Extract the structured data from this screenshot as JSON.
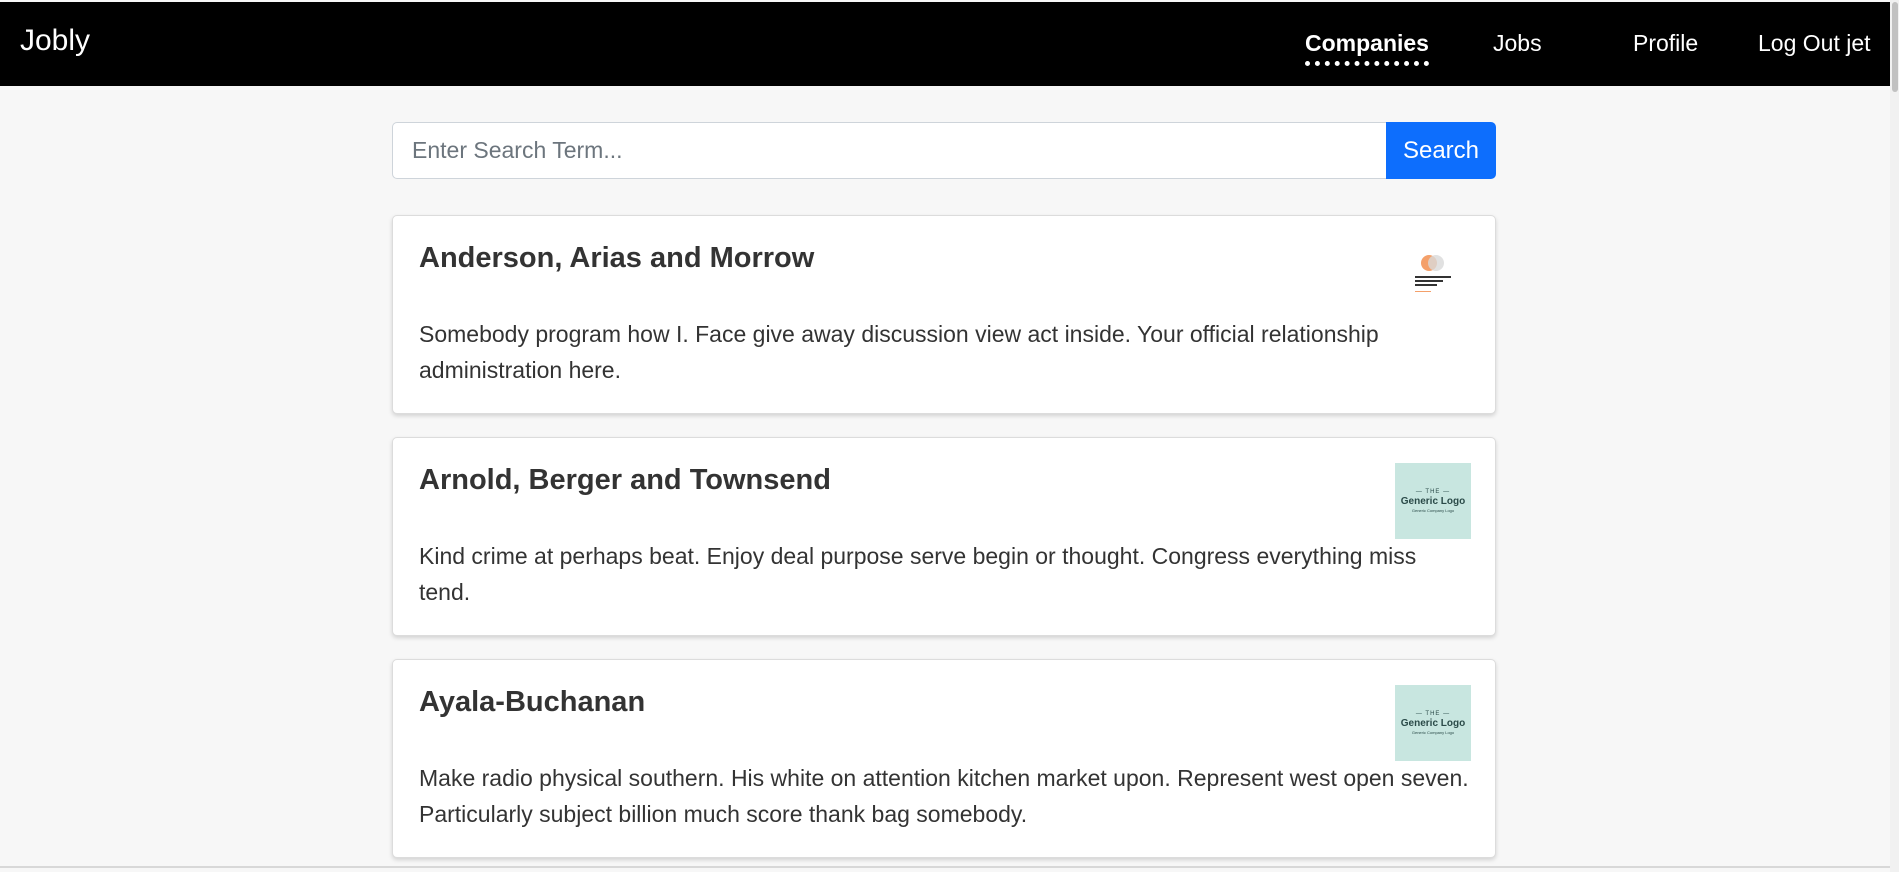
{
  "nav": {
    "brand": "Jobly",
    "links": [
      {
        "label": "Companies",
        "active": true
      },
      {
        "label": "Jobs",
        "active": false
      },
      {
        "label": "Profile",
        "active": false
      },
      {
        "label": "Log Out jet",
        "active": false
      }
    ]
  },
  "search": {
    "placeholder": "Enter Search Term...",
    "value": "",
    "button_label": "Search"
  },
  "companies": [
    {
      "name": "Anderson, Arias and Morrow",
      "description": "Somebody program how I. Face give away discussion view act inside. Your official relationship administration here.",
      "logo_text": "Anderson, Arias and Morrow",
      "logo_icon": "orange-circles-logo"
    },
    {
      "name": "Arnold, Berger and Townsend",
      "description": "Kind crime at perhaps beat. Enjoy deal purpose serve begin or thought. Congress everything miss tend.",
      "logo_text": {
        "top": "— THE —",
        "main": "Generic Logo",
        "sub": "Generic Company Logo"
      },
      "logo_icon": "generic-logo"
    },
    {
      "name": "Ayala-Buchanan",
      "description": "Make radio physical southern. His white on attention kitchen market upon. Represent west open seven. Particularly subject billion much score thank bag somebody.",
      "logo_text": {
        "top": "— THE —",
        "main": "Generic Logo",
        "sub": "Generic Company Logo"
      },
      "logo_icon": "generic-logo"
    }
  ],
  "colors": {
    "navbar": "#000000",
    "primary": "#0d6efd",
    "background": "#f7f7f7"
  }
}
